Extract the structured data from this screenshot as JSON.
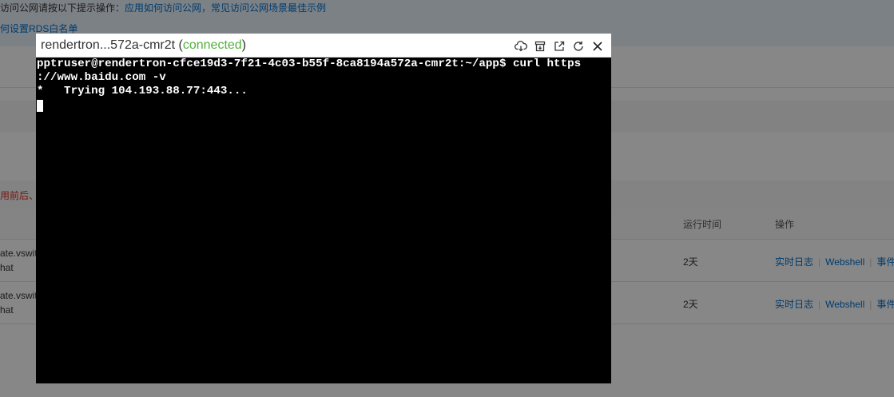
{
  "background": {
    "notice_text": "访问公网请按以下提示操作：",
    "notice_links": "应用如何访问公网，常见访问公网场景最佳示例",
    "rds_link": "何设置RDS白名单",
    "warning_text": "用前后、",
    "table": {
      "headers": [
        "运行时间",
        "操作"
      ],
      "rows": [
        {
          "name_line1": "ate.vswit",
          "name_line2": "hat",
          "uptime": "2天",
          "actions": [
            "实时日志",
            "Webshell",
            "事件"
          ]
        },
        {
          "name_line1": "ate.vswit",
          "name_line2": "hat",
          "uptime": "2天",
          "actions": [
            "实时日志",
            "Webshell",
            "事件"
          ]
        }
      ]
    }
  },
  "dialog": {
    "title": "rendertron...572a-cmr2t",
    "status": "connected",
    "tools": [
      "download-icon",
      "archive-icon",
      "external-link-icon",
      "refresh-icon",
      "close-icon"
    ],
    "terminal_lines": [
      "pptruser@rendertron-cfce19d3-7f21-4c03-b55f-8ca8194a572a-cmr2t:~/app$ curl https",
      "://www.baidu.com -v",
      "*   Trying 104.193.88.77:443..."
    ]
  }
}
